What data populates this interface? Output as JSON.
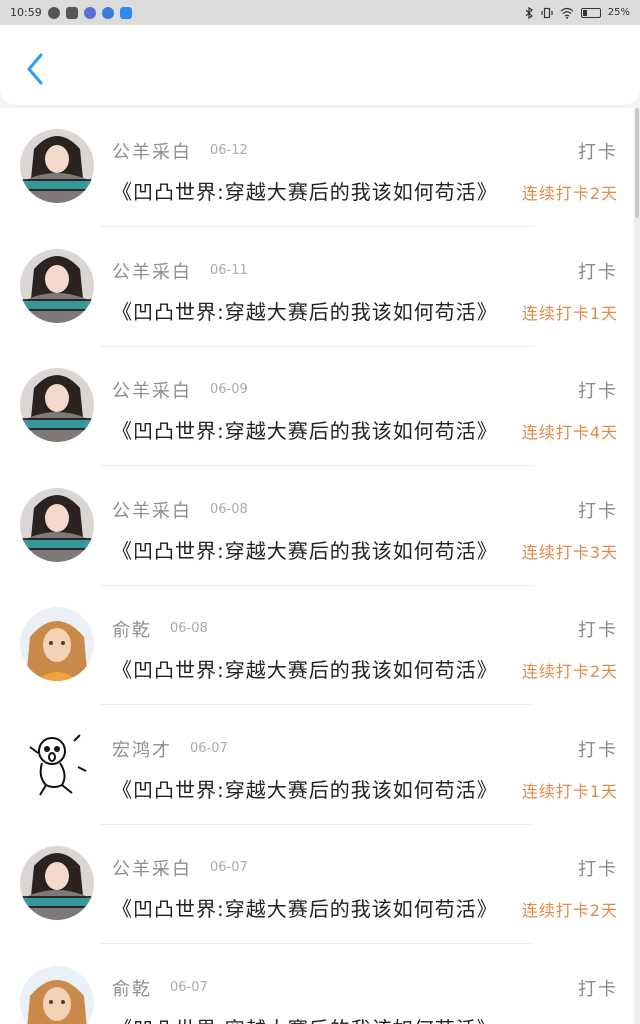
{
  "status_bar": {
    "time": "10:59",
    "battery": "25%",
    "battery_level": 0.25
  },
  "header": {
    "back_icon": "chevron-left-icon",
    "accent": "#2a9df4"
  },
  "colors": {
    "streak": "#e08a4a",
    "name": "#8e8e8e",
    "content": "#222222"
  },
  "entries": [
    {
      "name": "公羊采白",
      "date": "06-12",
      "action": "打卡",
      "content": "《凹凸世界:穿越大赛后的我该如何苟活》",
      "streak": "连续打卡2天",
      "avatar": "girl-gray-sweater"
    },
    {
      "name": "公羊采白",
      "date": "06-11",
      "action": "打卡",
      "content": "《凹凸世界:穿越大赛后的我该如何苟活》",
      "streak": "连续打卡1天",
      "avatar": "girl-gray-sweater"
    },
    {
      "name": "公羊采白",
      "date": "06-09",
      "action": "打卡",
      "content": "《凹凸世界:穿越大赛后的我该如何苟活》",
      "streak": "连续打卡4天",
      "avatar": "girl-gray-sweater"
    },
    {
      "name": "公羊采白",
      "date": "06-08",
      "action": "打卡",
      "content": "《凹凸世界:穿越大赛后的我该如何苟活》",
      "streak": "连续打卡3天",
      "avatar": "girl-gray-sweater"
    },
    {
      "name": "俞乾",
      "date": "06-08",
      "action": "打卡",
      "content": "《凹凸世界:穿越大赛后的我该如何苟活》",
      "streak": "连续打卡2天",
      "avatar": "child-orange"
    },
    {
      "name": "宏鸿才",
      "date": "06-07",
      "action": "打卡",
      "content": "《凹凸世界:穿越大赛后的我该如何苟活》",
      "streak": "连续打卡1天",
      "avatar": "cartoon-sketch"
    },
    {
      "name": "公羊采白",
      "date": "06-07",
      "action": "打卡",
      "content": "《凹凸世界:穿越大赛后的我该如何苟活》",
      "streak": "连续打卡2天",
      "avatar": "girl-gray-sweater"
    },
    {
      "name": "俞乾",
      "date": "06-07",
      "action": "打卡",
      "content": "《凹凸世界:穿越大赛后的我该如何苟活》",
      "streak": "",
      "avatar": "child-orange"
    }
  ]
}
